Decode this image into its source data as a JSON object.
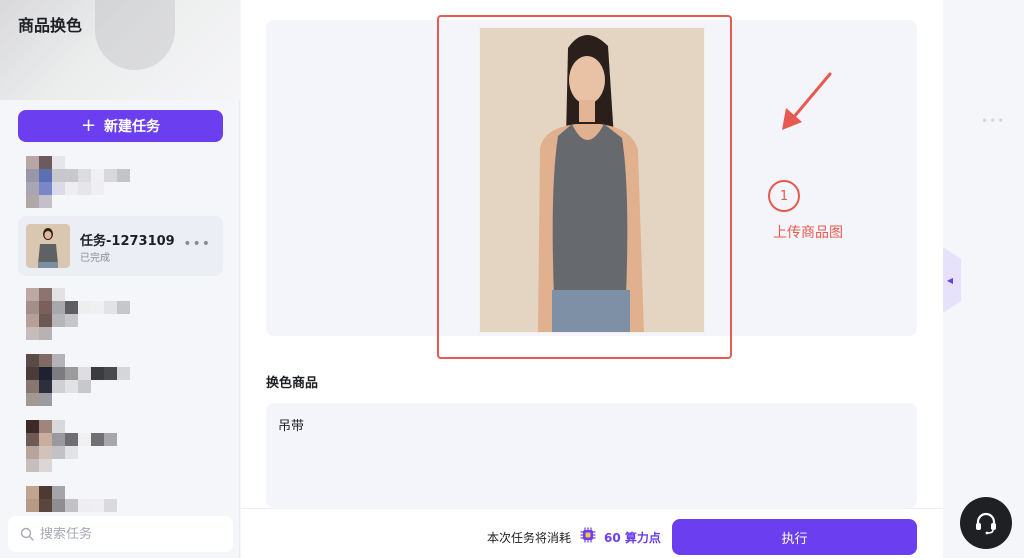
{
  "app": {
    "title": "商品换色"
  },
  "sidebar": {
    "new_task_label": "新建任务",
    "active_task": {
      "name": "任务-1273109",
      "status": "已完成"
    },
    "search_placeholder": "搜索任务"
  },
  "main": {
    "upload_annotation": {
      "step": "1",
      "label": "上传商品图"
    },
    "product_section_label": "换色商品",
    "product_text": "吊带"
  },
  "footer": {
    "cost_prefix": "本次任务将消耗",
    "cost_value": "60 算力点",
    "execute_label": "执行"
  },
  "icons": {
    "plus": "plus-icon",
    "more": "more-icon",
    "search": "search-icon",
    "chip": "chip-icon",
    "collapse": "collapse-arrow-icon",
    "headset": "headset-icon"
  },
  "colors": {
    "accent": "#6b3ef0",
    "annotation": "#e85a4f"
  }
}
